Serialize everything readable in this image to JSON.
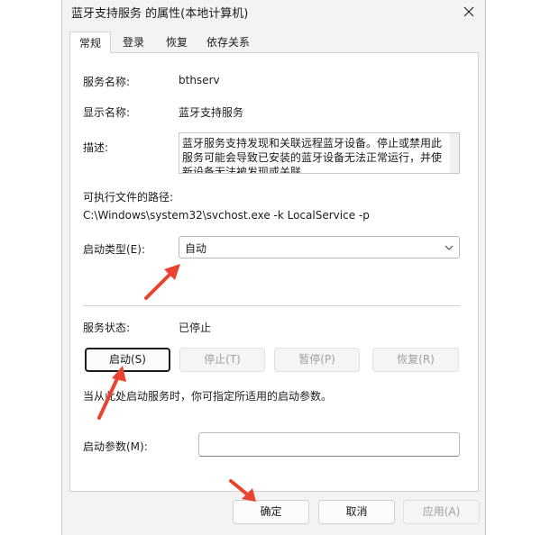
{
  "window": {
    "title": "蓝牙支持服务 的属性(本地计算机)"
  },
  "tabs": [
    {
      "label": "常规",
      "active": true
    },
    {
      "label": "登录",
      "active": false
    },
    {
      "label": "恢复",
      "active": false
    },
    {
      "label": "依存关系",
      "active": false
    }
  ],
  "general": {
    "service_name_label": "服务名称:",
    "service_name_value": "bthserv",
    "display_name_label": "显示名称:",
    "display_name_value": "蓝牙支持服务",
    "description_label": "描述:",
    "description_value": "蓝牙服务支持发现和关联远程蓝牙设备。停止或禁用此服务可能会导致已安装的蓝牙设备无法正常运行，并使新设备无法被发现或关联。",
    "exe_path_label": "可执行文件的路径:",
    "exe_path_value": "C:\\Windows\\system32\\svchost.exe -k LocalService -p",
    "startup_type_label": "启动类型(E):",
    "startup_type_value": "自动",
    "service_status_label": "服务状态:",
    "service_status_value": "已停止",
    "buttons": {
      "start": "启动(S)",
      "stop": "停止(T)",
      "pause": "暂停(P)",
      "resume": "恢复(R)"
    },
    "hint_text": "当从此处启动服务时，你可指定所适用的启动参数。",
    "start_params_label": "启动参数(M):",
    "start_params_value": ""
  },
  "footer": {
    "ok": "确定",
    "cancel": "取消",
    "apply": "应用(A)"
  },
  "colors": {
    "annotation_arrow": "#e8442f",
    "dialog_bg": "#f3f3f3",
    "panel_bg": "#ffffff",
    "disabled_text": "#a0a0a0"
  }
}
